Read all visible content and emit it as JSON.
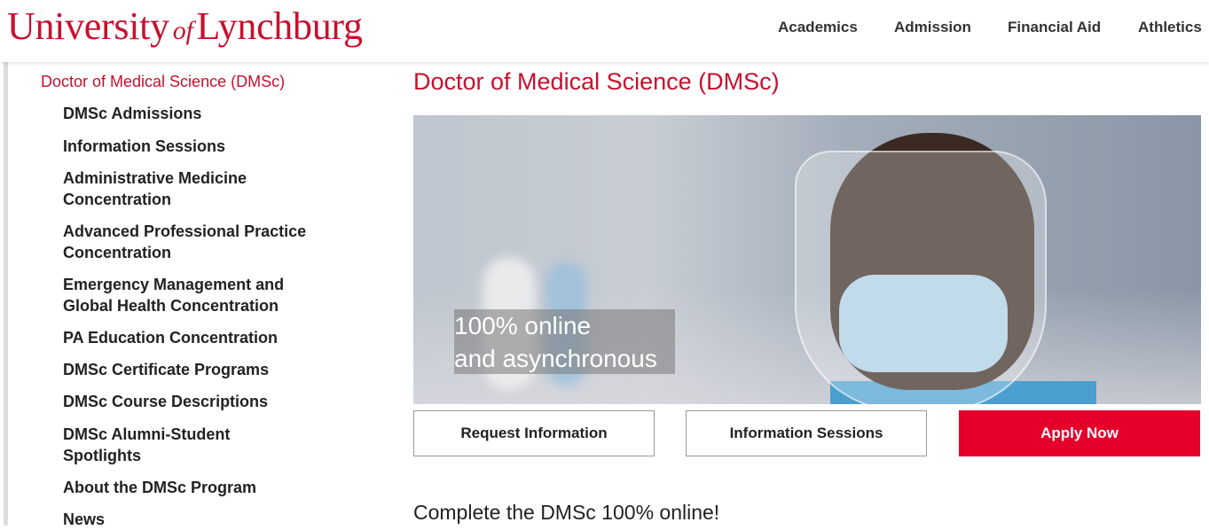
{
  "header": {
    "logo": {
      "university": "University",
      "of": "of",
      "lynchburg": "Lynchburg"
    },
    "nav": [
      "Academics",
      "Admission",
      "Financial Aid",
      "Athletics"
    ]
  },
  "sidebar": {
    "active": "Doctor of Medical Science (DMSc)",
    "items": [
      {
        "lines": [
          "DMSc Admissions"
        ]
      },
      {
        "lines": [
          "Information Sessions"
        ]
      },
      {
        "lines": [
          "Administrative Medicine",
          "Concentration"
        ]
      },
      {
        "lines": [
          "Advanced Professional Practice",
          "Concentration"
        ]
      },
      {
        "lines": [
          "Emergency Management and",
          "Global Health Concentration"
        ]
      },
      {
        "lines": [
          "PA Education Concentration"
        ]
      },
      {
        "lines": [
          "DMSc Certificate Programs"
        ]
      },
      {
        "lines": [
          "DMSc Course Descriptions"
        ]
      },
      {
        "lines": [
          "DMSc Alumni-Student",
          "Spotlights"
        ]
      },
      {
        "lines": [
          "About the DMSc Program"
        ]
      },
      {
        "lines": [
          "News"
        ]
      }
    ]
  },
  "main": {
    "title": "Doctor of Medical Science (DMSc)",
    "hero_caption": [
      "100% online",
      "and asynchronous"
    ],
    "buttons": {
      "request": "Request Information",
      "sessions": "Information Sessions",
      "apply": "Apply Now"
    },
    "subheading": "Complete the DMSc 100% online!"
  },
  "colors": {
    "brand_red": "#c8102e",
    "button_red": "#e4002b"
  }
}
